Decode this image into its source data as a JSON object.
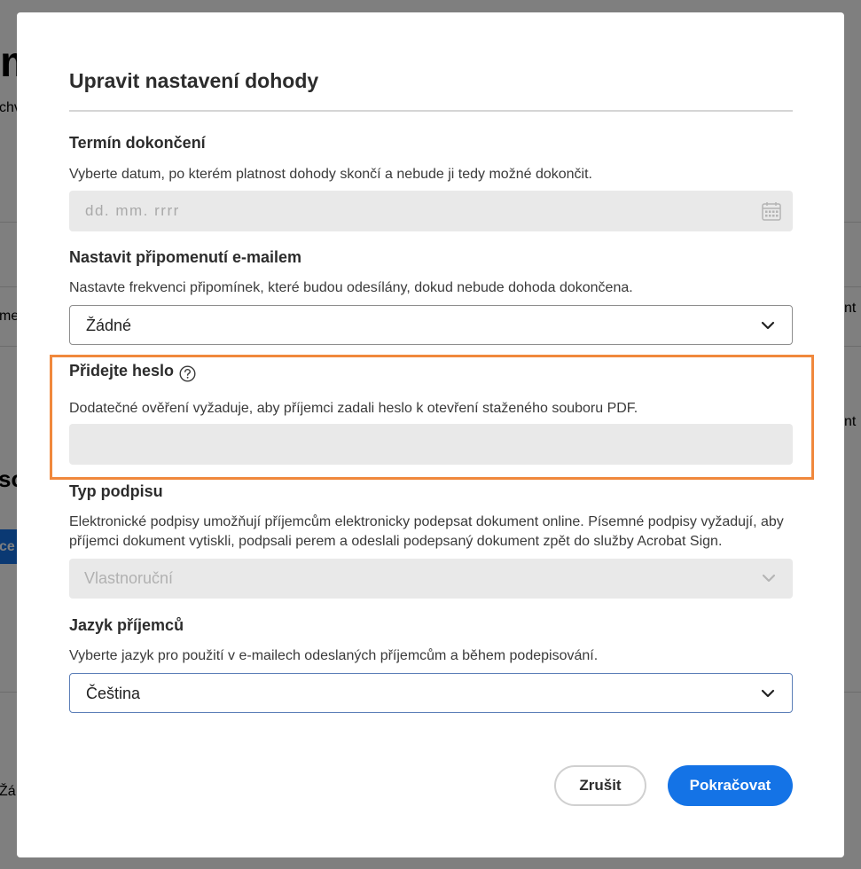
{
  "background": {
    "left": {
      "heading": "m",
      "subtitle": "chv",
      "column": "me",
      "section": "so",
      "button": "ce",
      "value": "Žá"
    },
    "right": {
      "column1": "nt",
      "column2": "nt"
    }
  },
  "dialog": {
    "title": "Upravit nastavení dohody",
    "deadline": {
      "label": "Termín dokončení",
      "description": "Vyberte datum, po kterém platnost dohody skončí a nebude ji tedy možné dokončit.",
      "placeholder": "dd. mm. rrrr",
      "icon": "calendar-icon"
    },
    "reminder": {
      "label": "Nastavit připomenutí e-mailem",
      "description": "Nastavte frekvenci připomínek, které budou odesílány, dokud nebude dohoda dokončena.",
      "selected": "Žádné",
      "icon": "chevron-down-icon"
    },
    "password": {
      "label": "Přidejte heslo",
      "description": "Dodatečné ověření vyžaduje, aby příjemci zadali heslo k otevření staženého souboru PDF.",
      "help_icon": "help-icon"
    },
    "signature_type": {
      "label": "Typ podpisu",
      "description_lines": [
        "Elektronické podpisy umožňují příjemcům elektronicky podepsat dokument online. Písemné podpisy vyžadují, aby",
        "příjemci dokument vytiskli, podpsali perem a odeslali podepsaný dokument zpět do služby Acrobat Sign."
      ],
      "selected": "Vlastnoruční",
      "disabled": true,
      "icon": "chevron-down-icon"
    },
    "language": {
      "label": "Jazyk příjemců",
      "description": "Vyberte jazyk pro použití v e-mailech odeslaných příjemcům a během podepisování.",
      "selected": "Čeština",
      "icon": "chevron-down-icon"
    },
    "buttons": {
      "cancel": "Zrušit",
      "continue": "Pokračovat"
    }
  },
  "colors": {
    "accent": "#1473e6",
    "highlight": "#f0883c"
  }
}
